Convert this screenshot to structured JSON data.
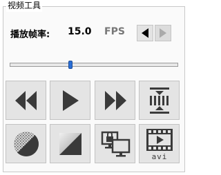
{
  "panel": {
    "title": "视频工具"
  },
  "fps": {
    "label": "播放帧率:",
    "value": "15.0",
    "unit": "FPS"
  },
  "slider": {
    "position": 0.36
  },
  "tools": {
    "row1": [
      {
        "name": "rewind-button",
        "icon": "rewind-icon"
      },
      {
        "name": "play-button",
        "icon": "play-icon"
      },
      {
        "name": "fast-forward-button",
        "icon": "fast-forward-icon"
      },
      {
        "name": "frame-split-button",
        "icon": "frame-split-icon"
      }
    ],
    "row2": [
      {
        "name": "noise-circle-button",
        "icon": "noise-circle-icon"
      },
      {
        "name": "gradient-button",
        "icon": "gradient-icon"
      },
      {
        "name": "remote-display-button",
        "icon": "remote-display-icon"
      },
      {
        "name": "export-avi-button",
        "icon": "avi-film-icon",
        "label": "avi"
      }
    ]
  },
  "colors": {
    "icon": "#3a3a3a",
    "slider_thumb": "#2a6fd6"
  }
}
